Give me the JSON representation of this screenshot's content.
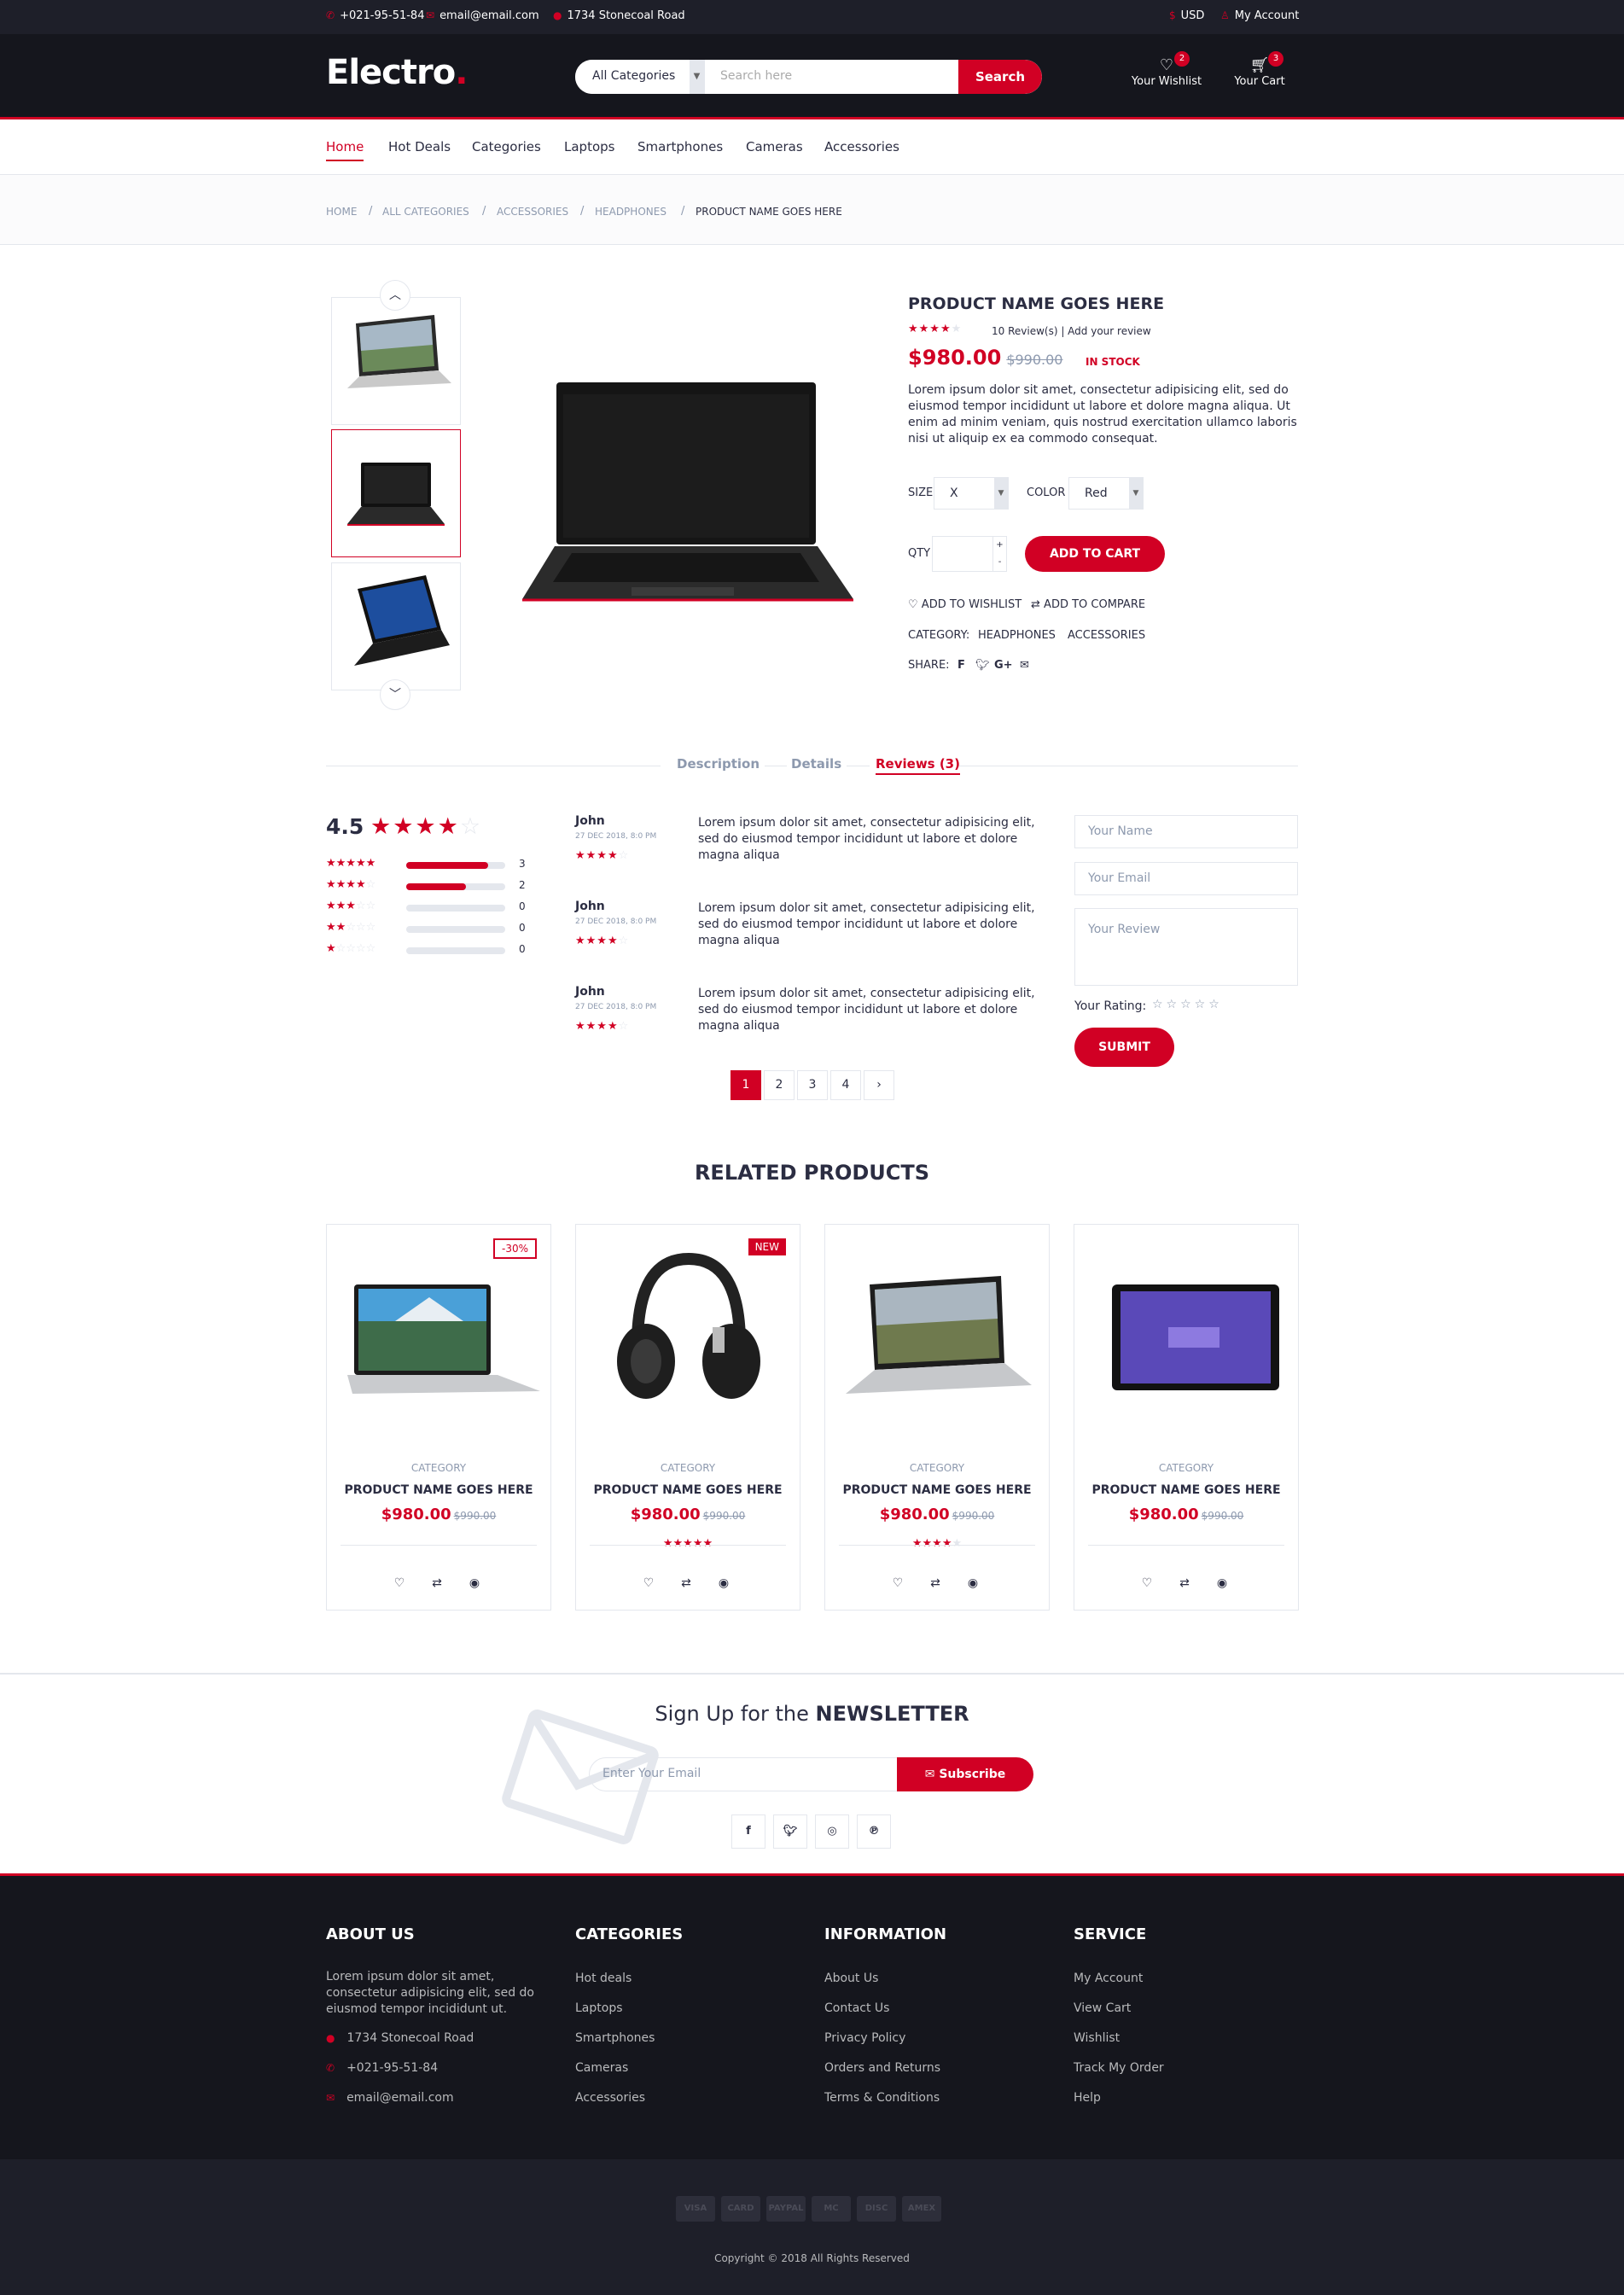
{
  "topbar": {
    "phone": "+021-95-51-84",
    "email": "email@email.com",
    "address": "1734 Stonecoal Road",
    "currency": "USD",
    "account": "My Account"
  },
  "header": {
    "logo": "Electro",
    "logo_dot": ".",
    "search_category": "All Categories",
    "search_placeholder": "Search here",
    "search_button": "Search",
    "wishlist_label": "Your Wishlist",
    "wishlist_count": "2",
    "cart_label": "Your Cart",
    "cart_count": "3"
  },
  "nav": [
    "Home",
    "Hot Deals",
    "Categories",
    "Laptops",
    "Smartphones",
    "Cameras",
    "Accessories"
  ],
  "breadcrumb": [
    "HOME",
    "ALL CATEGORIES",
    "ACCESSORIES",
    "HEADPHONES",
    "PRODUCT NAME GOES HERE"
  ],
  "product": {
    "name": "PRODUCT NAME GOES HERE",
    "rating": 4,
    "reviews_link": "10 Review(s) | Add your review",
    "price": "$980.00",
    "old_price": "$990.00",
    "stock": "IN STOCK",
    "description": "Lorem ipsum dolor sit amet, consectetur adipisicing elit, sed do eiusmod tempor incididunt ut labore et dolore magna aliqua. Ut enim ad minim veniam, quis nostrud exercitation ullamco laboris nisi ut aliquip ex ea commodo consequat.",
    "size_label": "SIZE",
    "size_value": "X",
    "color_label": "COLOR",
    "color_value": "Red",
    "qty_label": "QTY",
    "add_to_cart": "ADD TO CART",
    "add_wishlist": "ADD TO WISHLIST",
    "add_compare": "ADD TO COMPARE",
    "category_label": "CATEGORY:",
    "categories": [
      "HEADPHONES",
      "ACCESSORIES"
    ],
    "share_label": "SHARE:"
  },
  "tabs": [
    "Description",
    "Details",
    "Reviews (3)"
  ],
  "rating_summary": {
    "average": "4.5",
    "rows": [
      {
        "stars": 5,
        "fill": 0.83,
        "count": "3"
      },
      {
        "stars": 4,
        "fill": 0.6,
        "count": "2"
      },
      {
        "stars": 3,
        "fill": 0,
        "count": "0"
      },
      {
        "stars": 2,
        "fill": 0,
        "count": "0"
      },
      {
        "stars": 1,
        "fill": 0,
        "count": "0"
      }
    ]
  },
  "reviews": [
    {
      "name": "John",
      "date": "27 DEC 2018, 8:0 PM",
      "rating": 4,
      "text": "Lorem ipsum dolor sit amet, consectetur adipisicing elit, sed do eiusmod tempor incididunt ut labore et dolore magna aliqua"
    },
    {
      "name": "John",
      "date": "27 DEC 2018, 8:0 PM",
      "rating": 4,
      "text": "Lorem ipsum dolor sit amet, consectetur adipisicing elit, sed do eiusmod tempor incididunt ut labore et dolore magna aliqua"
    },
    {
      "name": "John",
      "date": "27 DEC 2018, 8:0 PM",
      "rating": 4,
      "text": "Lorem ipsum dolor sit amet, consectetur adipisicing elit, sed do eiusmod tempor incididunt ut labore et dolore magna aliqua"
    }
  ],
  "review_form": {
    "name_placeholder": "Your Name",
    "email_placeholder": "Your Email",
    "review_placeholder": "Your Review",
    "rating_label": "Your Rating:",
    "submit": "SUBMIT"
  },
  "pagination": [
    "1",
    "2",
    "3",
    "4",
    "›"
  ],
  "related": {
    "title": "RELATED PRODUCTS",
    "items": [
      {
        "badge": "-30%",
        "category": "CATEGORY",
        "name": "PRODUCT NAME GOES HERE",
        "price": "$980.00",
        "old_price": "$990.00",
        "rating": 0
      },
      {
        "badge": "NEW",
        "category": "CATEGORY",
        "name": "PRODUCT NAME GOES HERE",
        "price": "$980.00",
        "old_price": "$990.00",
        "rating": 5
      },
      {
        "badge": "",
        "category": "CATEGORY",
        "name": "PRODUCT NAME GOES HERE",
        "price": "$980.00",
        "old_price": "$990.00",
        "rating": 4
      },
      {
        "badge": "",
        "category": "CATEGORY",
        "name": "PRODUCT NAME GOES HERE",
        "price": "$980.00",
        "old_price": "$990.00",
        "rating": 0
      }
    ]
  },
  "newsletter": {
    "title_pre": "Sign Up for the",
    "title_bold": "NEWSLETTER",
    "placeholder": "Enter Your Email",
    "button": "Subscribe"
  },
  "footer": {
    "about_title": "ABOUT US",
    "about_text": "Lorem ipsum dolor sit amet, consectetur adipisicing elit, sed do eiusmod tempor incididunt ut.",
    "address": "1734 Stonecoal Road",
    "phone": "+021-95-51-84",
    "email": "email@email.com",
    "categories_title": "CATEGORIES",
    "categories": [
      "Hot deals",
      "Laptops",
      "Smartphones",
      "Cameras",
      "Accessories"
    ],
    "info_title": "INFORMATION",
    "info": [
      "About Us",
      "Contact Us",
      "Privacy Policy",
      "Orders and Returns",
      "Terms & Conditions"
    ],
    "service_title": "SERVICE",
    "service": [
      "My Account",
      "View Cart",
      "Wishlist",
      "Track My Order",
      "Help"
    ],
    "payments": [
      "VISA",
      "CARD",
      "PAYPAL",
      "MC",
      "DISC",
      "AMEX"
    ],
    "copyright": "Copyright © 2018 All Rights Reserved"
  },
  "colors": {
    "accent": "#d10024",
    "dark": "#15161d",
    "darker": "#1e1f29",
    "text": "#2b2d42",
    "muted": "#8d99ae",
    "border": "#e4e7ed"
  }
}
